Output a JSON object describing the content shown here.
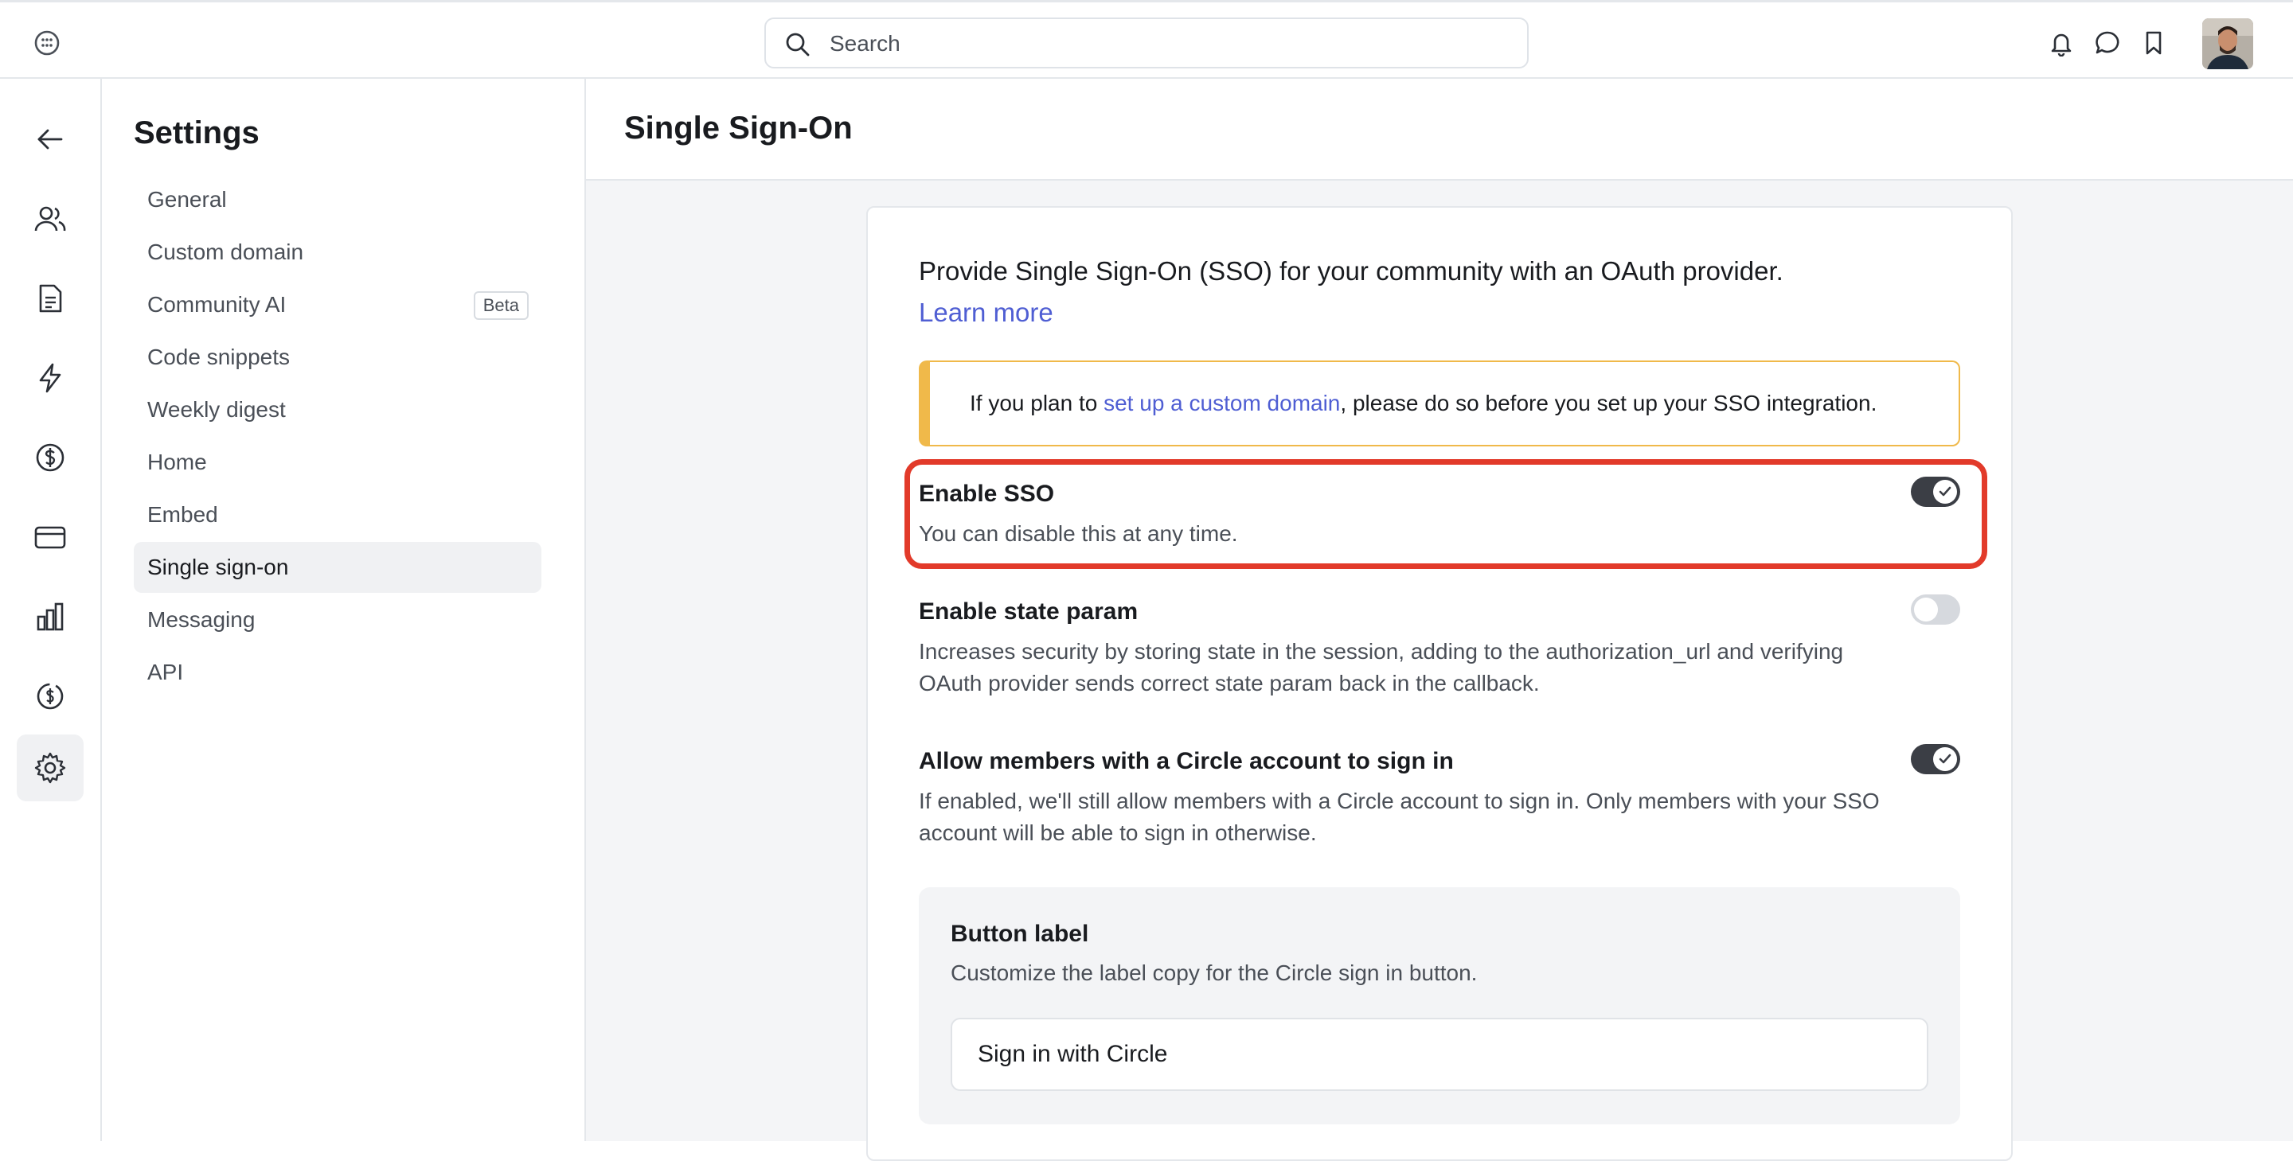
{
  "topbar": {
    "search_placeholder": "Search"
  },
  "settings_nav": {
    "title": "Settings",
    "items": [
      {
        "label": "General"
      },
      {
        "label": "Custom domain"
      },
      {
        "label": "Community AI",
        "badge": "Beta"
      },
      {
        "label": "Code snippets"
      },
      {
        "label": "Weekly digest"
      },
      {
        "label": "Home"
      },
      {
        "label": "Embed"
      },
      {
        "label": "Single sign-on",
        "active": true
      },
      {
        "label": "Messaging"
      },
      {
        "label": "API"
      }
    ]
  },
  "rail_icons": [
    "back-arrow-icon",
    "members-icon",
    "document-icon",
    "bolt-icon",
    "dollar-icon",
    "card-icon",
    "chart-icon",
    "paywall-icon",
    "gear-icon"
  ],
  "page": {
    "title": "Single Sign-On",
    "intro_text": "Provide Single Sign-On (SSO) for your community with an OAuth provider.",
    "intro_link": "Learn more",
    "notice": {
      "prefix": "If you plan to ",
      "link": "set up a custom domain",
      "suffix": ", please do so before you set up your SSO integration."
    },
    "settings": [
      {
        "title": "Enable SSO",
        "description": "You can disable this at any time.",
        "enabled": true
      },
      {
        "title": "Enable state param",
        "description": "Increases security by storing state in the session, adding to the authorization_url and verifying OAuth provider sends correct state param back in the callback.",
        "enabled": false
      },
      {
        "title": "Allow members with a Circle account to sign in",
        "description": "If enabled, we'll still allow members with a Circle account to sign in. Only members with your SSO account will be able to sign in otherwise.",
        "enabled": true
      }
    ],
    "button_label": {
      "title": "Button label",
      "description": "Customize the label copy for the Circle sign in button.",
      "value": "Sign in with Circle"
    }
  },
  "colors": {
    "accent_link": "#4f5ed3",
    "notice_border": "#f0b94a",
    "highlight_border": "#e23a2a",
    "toggle_on": "#3b3e45",
    "toggle_off": "#d6d9de"
  }
}
